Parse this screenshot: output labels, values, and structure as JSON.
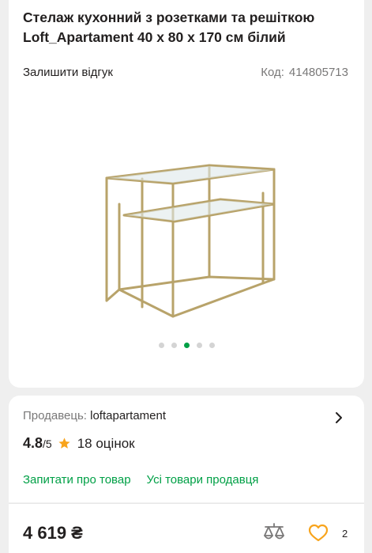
{
  "product": {
    "title_line1": "Стелаж кухонний з розетками та решіткою",
    "title_line2": "Loft_Apartament 40 х 80 х 170 см білий",
    "review_link": "Залишити відгук",
    "code_label": "Код:",
    "code_value": "414805713",
    "gallery": {
      "total_slides": 5,
      "active_slide": 3
    }
  },
  "seller": {
    "label": "Продавець:",
    "name": "loftapartament",
    "rating": "4.8",
    "rating_max": "/5",
    "reviews": "18 оцінок",
    "ask_link": "Запитати про товар",
    "all_items_link": "Усі товари продавця"
  },
  "bottom_bar": {
    "price": "4 619 ₴",
    "wishlist_count": "2"
  },
  "colors": {
    "accent_green": "#00a046",
    "star": "#f8a41c",
    "heart": "#f8a41c",
    "frame_gold": "#b8a36a"
  },
  "icons": [
    "star-icon",
    "chevron-right-icon",
    "compare-icon",
    "heart-icon"
  ]
}
